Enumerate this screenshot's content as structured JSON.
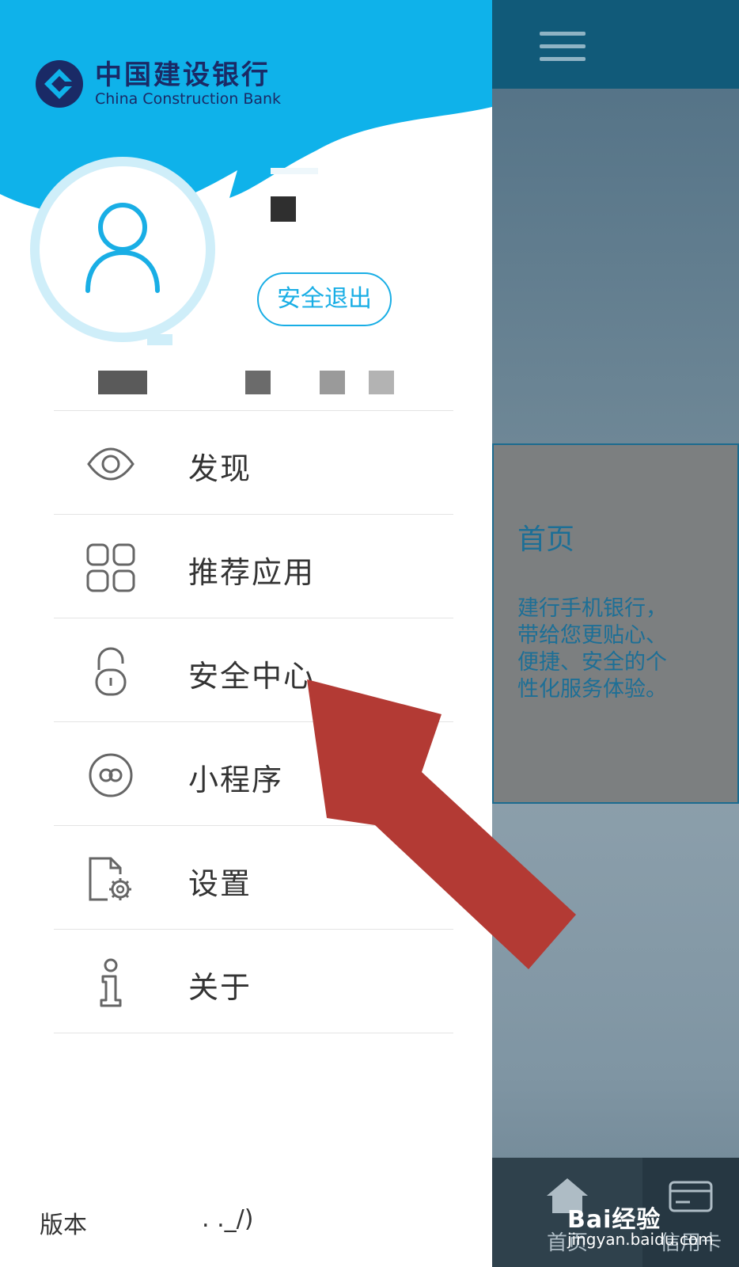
{
  "brand": {
    "name_cn": "中国建设银行",
    "name_en": "China Construction Bank",
    "logo_icon": "ccb-logo-icon"
  },
  "profile": {
    "avatar_icon": "user-avatar-icon",
    "logout_label": "安全退出"
  },
  "menu": {
    "items": [
      {
        "label": "发现",
        "icon": "eye-icon"
      },
      {
        "label": "推荐应用",
        "icon": "apps-grid-icon"
      },
      {
        "label": "安全中心",
        "icon": "lock-icon"
      },
      {
        "label": "小程序",
        "icon": "mini-program-icon"
      },
      {
        "label": "设置",
        "icon": "settings-icon"
      },
      {
        "label": "关于",
        "icon": "info-icon"
      }
    ]
  },
  "footer": {
    "version_label": "版本",
    "version_value": ". ._/)"
  },
  "background_app": {
    "tile_title": "首页",
    "tile_description": "建行手机银行，带给您更贴心、便捷、安全的个性化服务体验。",
    "nav": {
      "home_label": "首页",
      "card_label": "信用卡"
    }
  },
  "watermark": {
    "text": "Bai经验",
    "url": "jingyan.baidu.com"
  },
  "colors": {
    "header_blue": "#0fb2ea",
    "accent": "#19aee5",
    "annotation_red": "#b33a34",
    "brand_navy": "#1a2a66"
  }
}
